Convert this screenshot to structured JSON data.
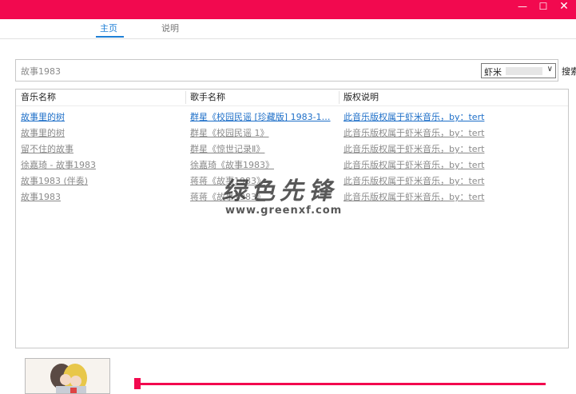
{
  "window": {
    "minimize_glyph": "—",
    "maximize_glyph": "☐",
    "close_glyph": "✕"
  },
  "tabs": [
    {
      "label": "主页",
      "active": true
    },
    {
      "label": "说明",
      "active": false
    }
  ],
  "search": {
    "value": "故事1983",
    "source": "虾米",
    "button": "搜索"
  },
  "table": {
    "headers": [
      "音乐名称",
      "歌手名称",
      "版权说明"
    ],
    "rows": [
      {
        "title": "故事里的树",
        "artist": "群星《校园民谣 [珍藏版] 1983-1…",
        "copyright": "此音乐版权属于虾米音乐，by：tert",
        "selected": true
      },
      {
        "title": "故事里的树",
        "artist": "群星《校园民谣 1》",
        "copyright": "此音乐版权属于虾米音乐，by：tert",
        "selected": false
      },
      {
        "title": "留不住的故事",
        "artist": "群星《惊世记录Ⅱ》",
        "copyright": "此音乐版权属于虾米音乐，by：tert",
        "selected": false
      },
      {
        "title": "徐嘉琦 - 故事1983",
        "artist": "徐嘉琦《故事1983》",
        "copyright": "此音乐版权属于虾米音乐，by：tert",
        "selected": false
      },
      {
        "title": "故事1983 (伴奏)",
        "artist": "蒋蒋《故事1983》",
        "copyright": "此音乐版权属于虾米音乐，by：tert",
        "selected": false
      },
      {
        "title": "故事1983",
        "artist": "蒋蒋《故事1983》",
        "copyright": "此音乐版权属于虾米音乐，by：tert",
        "selected": false
      }
    ]
  },
  "player": {
    "progress": 0.0
  },
  "watermark": {
    "big": "绿色先锋",
    "small": "www.greenxf.com"
  },
  "colors": {
    "accent": "#f2094f",
    "link_selected": "#1e6fc8",
    "link": "#8a8a8a",
    "tab_active": "#1e7fd6"
  }
}
